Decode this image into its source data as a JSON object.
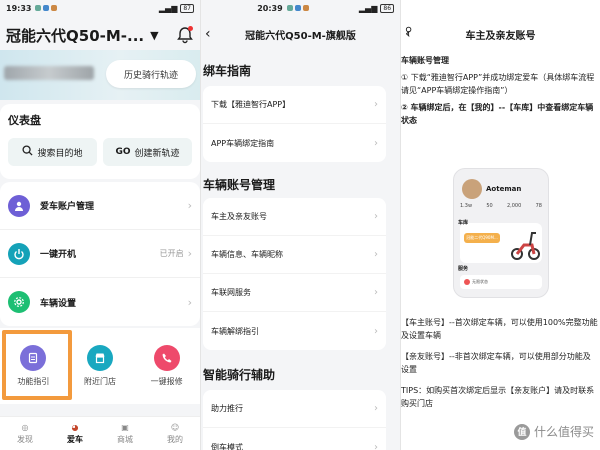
{
  "panel1": {
    "status": {
      "time": "19:33",
      "battery": "87"
    },
    "title": "冠能六代Q50-M-...",
    "history_button": "历史骑行轨迹",
    "dashboard": {
      "title": "仪表盘",
      "search_label": "搜索目的地",
      "go_badge": "GO",
      "create_route_label": "创建新轨迹"
    },
    "list": [
      {
        "label": "爱车账户管理",
        "meta": "",
        "icon": "users-icon",
        "color": "#6e5fd6"
      },
      {
        "label": "一键开机",
        "meta": "已开启",
        "icon": "power-icon",
        "color": "#15a2b8"
      },
      {
        "label": "车辆设置",
        "meta": "",
        "icon": "gear-icon",
        "color": "#1dbf73"
      }
    ],
    "quick_actions": [
      {
        "label": "功能指引",
        "icon": "document-icon",
        "color": "#7b6fd9"
      },
      {
        "label": "附近门店",
        "icon": "store-icon",
        "color": "#19a8c0"
      },
      {
        "label": "一键报修",
        "icon": "phone-icon",
        "color": "#ee4a6b"
      }
    ],
    "tabs": [
      {
        "label": "发现",
        "active": false
      },
      {
        "label": "爱车",
        "active": true
      },
      {
        "label": "商城",
        "active": false
      },
      {
        "label": "我的",
        "active": false
      }
    ]
  },
  "panel2": {
    "status": {
      "time": "20:39",
      "battery": "86"
    },
    "nav_title": "冠能六代Q50-M-旗舰版",
    "sections": [
      {
        "title": "绑车指南",
        "items": [
          "下载【雅迪智行APP】",
          "APP车辆绑定指南"
        ]
      },
      {
        "title": "车辆账号管理",
        "items": [
          "车主及亲友账号",
          "车辆信息、车辆昵称",
          "车联网服务",
          "车辆解绑指引"
        ]
      },
      {
        "title": "智能骑行辅助",
        "items": [
          "助力推行",
          "倒车模式"
        ]
      }
    ]
  },
  "panel3": {
    "nav_title": "车主及亲友账号",
    "heading": "车辆账号管理",
    "para1": "① 下载“雅迪智行APP”并成功绑定爱车（具体绑车流程请见“APP车辆绑定操作指南”）",
    "para2": "② 车辆绑定后，在【我的】--【车库】中查看绑定车辆状态",
    "mock": {
      "name": "Aoteman",
      "stats": [
        "1.3w",
        "50",
        "2,000",
        "78"
      ],
      "garage": "车库",
      "chip": "冠能二代Q90M...",
      "service": "服务",
      "service_item": "无限状态"
    },
    "para3": "【车主账号】--首次绑定车辆，可以使用100%完整功能及设置车辆",
    "para4": "【亲友账号】--非首次绑定车辆，可以使用部分功能及设置",
    "tips": "TIPS：如购买首次绑定后显示【亲友账户】请及时联系购买门店",
    "watermark": "什么值得买"
  }
}
